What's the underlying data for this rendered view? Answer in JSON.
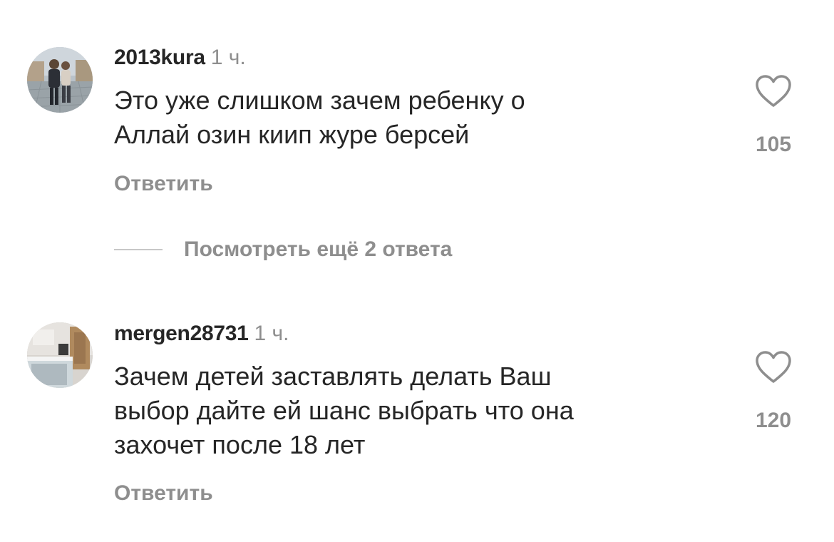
{
  "comments": [
    {
      "username": "2013kura",
      "time": "1 ч.",
      "lines": [
        "Это уже слишком зачем ребенку о",
        "Аллай озин киип журе берсей"
      ],
      "likes": "105",
      "reply_label": "Ответить"
    },
    {
      "username": "mergen28731",
      "time": "1 ч.",
      "lines": [
        "Зачем детей заставлять делать Ваш",
        "выбор дайте ей шанс выбрать что она",
        "захочет после 18 лет"
      ],
      "likes": "120",
      "reply_label": "Ответить"
    }
  ],
  "view_replies": {
    "label": "Посмотреть ещё 2 ответа"
  },
  "icons": {
    "like": "heart-outline-icon"
  },
  "colors": {
    "text": "#262626",
    "secondary": "#8e8e8e",
    "divider": "#c7c7c7"
  }
}
